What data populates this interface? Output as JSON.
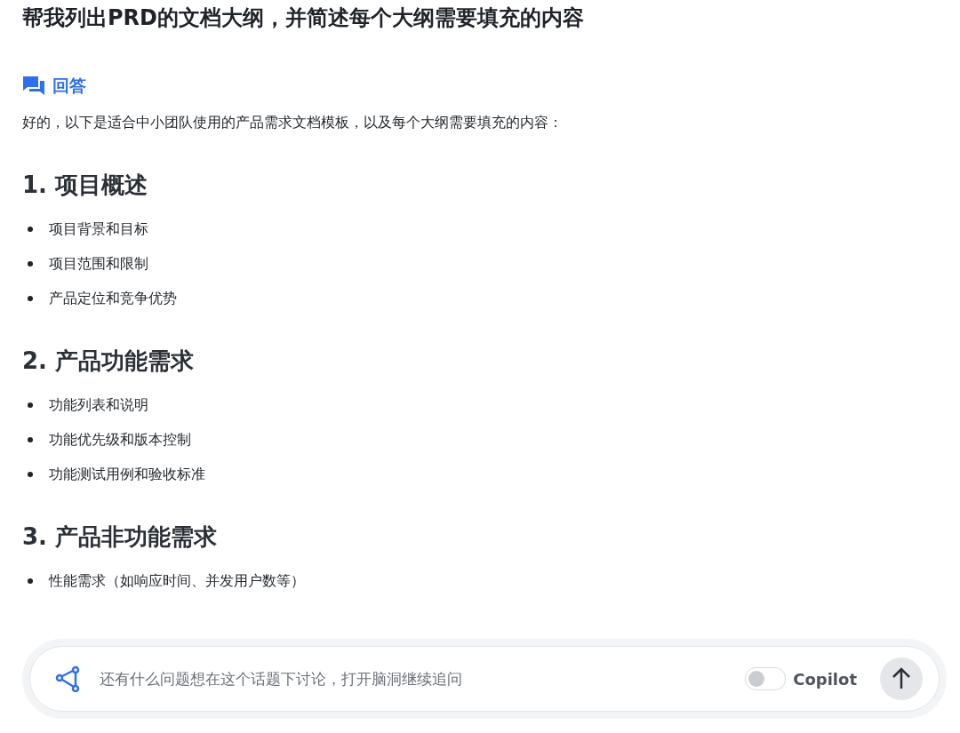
{
  "question": "帮我列出PRD的文档大纲，并简述每个大纲需要填充的内容",
  "answer": {
    "label": "回答",
    "intro": "好的，以下是适合中小团队使用的产品需求文档模板，以及每个大纲需要填充的内容：",
    "sections": [
      {
        "heading": "1. 项目概述",
        "items": [
          "项目背景和目标",
          "项目范围和限制",
          "产品定位和竞争优势"
        ]
      },
      {
        "heading": "2. 产品功能需求",
        "items": [
          "功能列表和说明",
          "功能优先级和版本控制",
          "功能测试用例和验收标准"
        ]
      },
      {
        "heading": "3. 产品非功能需求",
        "items": [
          "性能需求（如响应时间、并发用户数等）"
        ]
      }
    ]
  },
  "composer": {
    "placeholder": "还有什么问题想在这个话题下讨论，打开脑洞继续追问",
    "copilot": {
      "label": "Copilot",
      "on": false
    }
  }
}
